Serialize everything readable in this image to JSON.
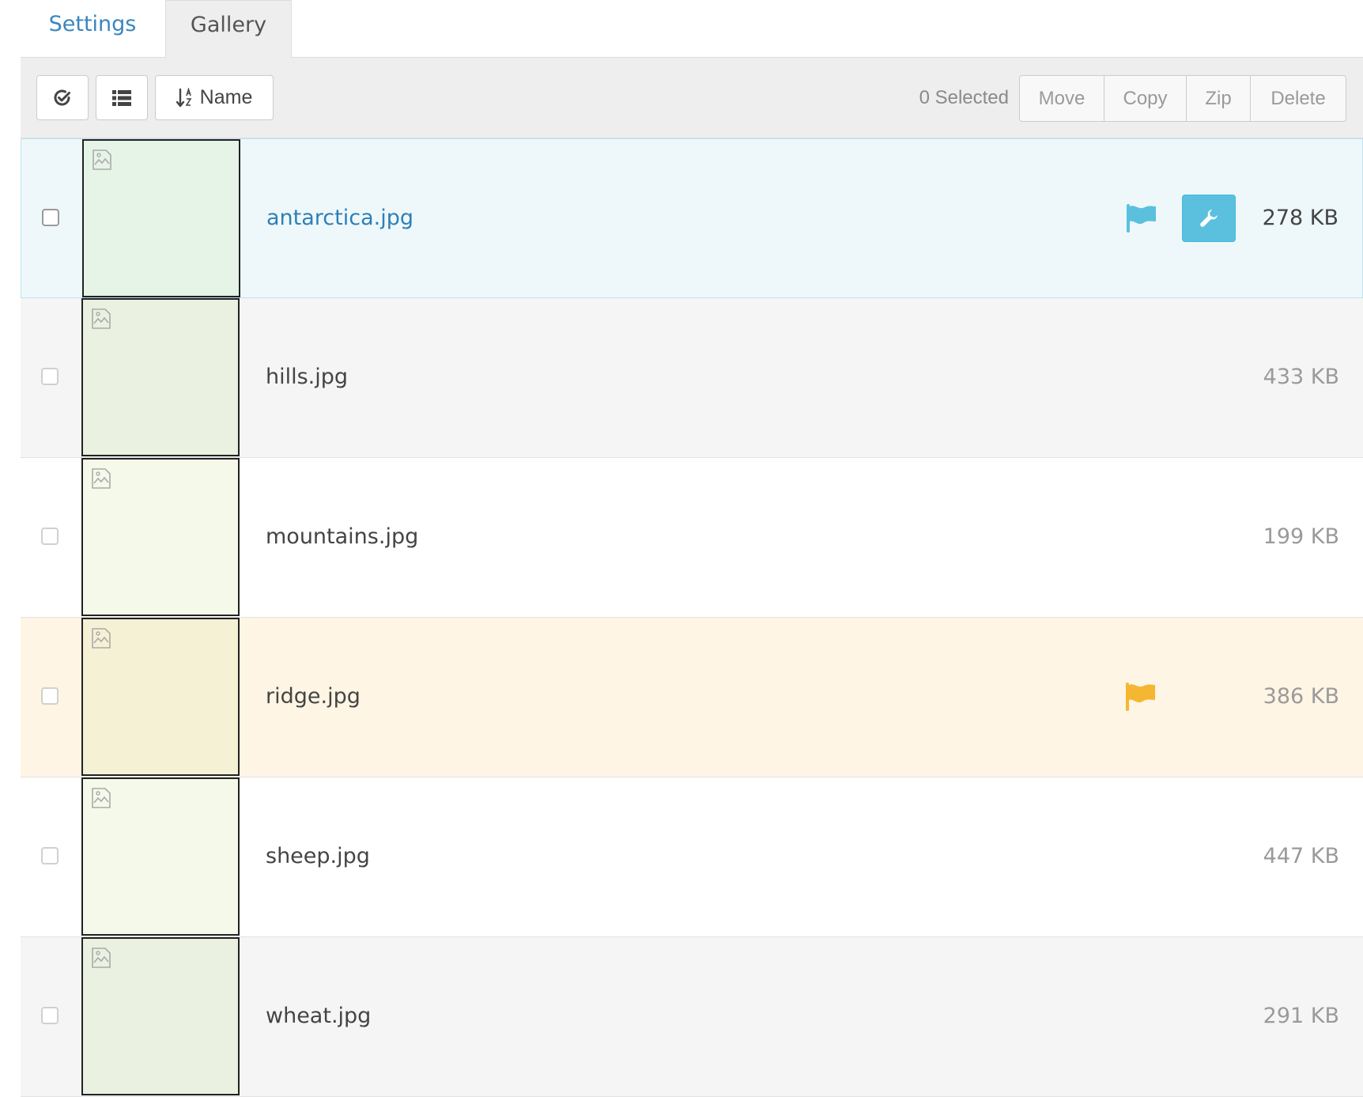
{
  "tabs": [
    {
      "label": "Settings"
    },
    {
      "label": "Gallery"
    }
  ],
  "toolbar": {
    "check_icon": "check-circle-icon",
    "list_icon": "list-icon",
    "sort_icon": "sort-alpha-icon",
    "sort_label": "Name",
    "selected_count": "0 Selected",
    "actions": {
      "move": "Move",
      "copy": "Copy",
      "zip": "Zip",
      "delete": "Delete"
    }
  },
  "colors": {
    "accent_blue": "#5bc0de",
    "flag_orange": "#f5b731",
    "link_blue": "#2f7fb5"
  },
  "files": [
    {
      "name": "antarctica.jpg",
      "size": "278 KB"
    },
    {
      "name": "hills.jpg",
      "size": "433 KB"
    },
    {
      "name": "mountains.jpg",
      "size": "199 KB"
    },
    {
      "name": "ridge.jpg",
      "size": "386 KB"
    },
    {
      "name": "sheep.jpg",
      "size": "447 KB"
    },
    {
      "name": "wheat.jpg",
      "size": "291 KB"
    }
  ]
}
